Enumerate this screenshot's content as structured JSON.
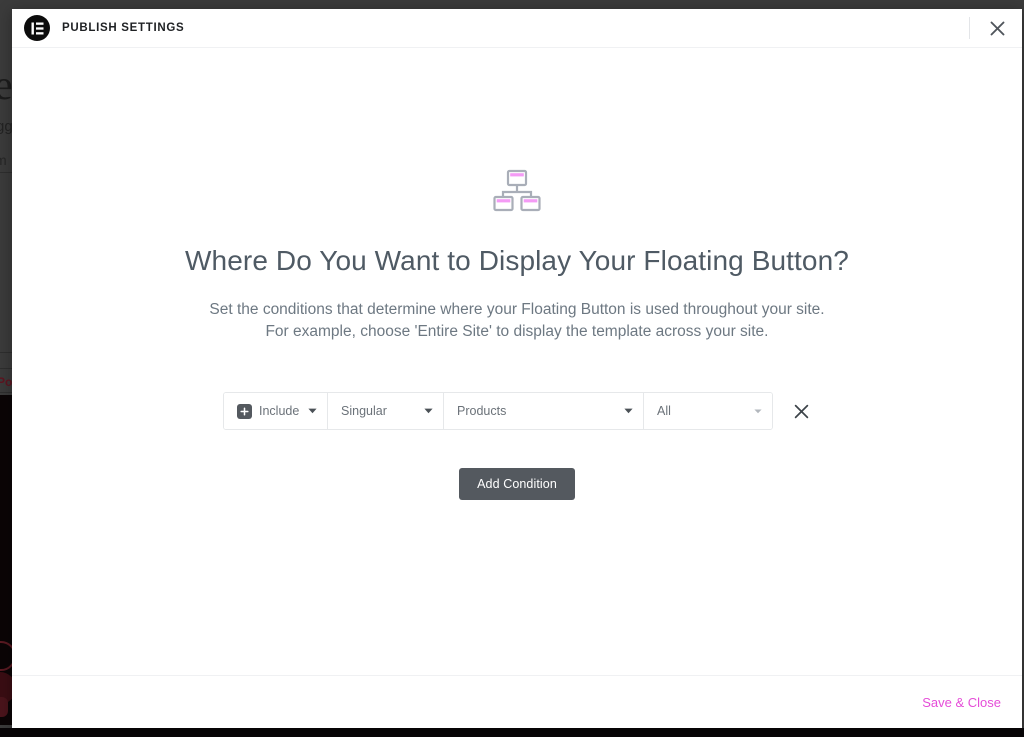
{
  "window": {
    "background_color": "#3b3b3b"
  },
  "background_page": {
    "fragment_e": "e",
    "fragment_gg": "gg",
    "fragment_m": "m",
    "fragment_po": "Po"
  },
  "header": {
    "logo_icon": "elementor-logo-icon",
    "title": "PUBLISH SETTINGS",
    "close_icon": "close-icon"
  },
  "main": {
    "illustration_icon": "sitemap-hierarchy-icon",
    "headline": "Where Do You Want to Display Your Floating Button?",
    "description_line1": "Set the conditions that determine where your Floating Button is used throughout your site.",
    "description_line2": "For example, choose 'Entire Site' to display the template across your site.",
    "conditions": [
      {
        "type_icon": "plus-icon",
        "type": "Include",
        "scope": "Singular",
        "object": "Products",
        "value": "All",
        "remove_icon": "close-icon"
      }
    ],
    "add_condition_label": "Add Condition"
  },
  "footer": {
    "save_close_label": "Save & Close"
  },
  "colors": {
    "accent_pink": "#e54dd8",
    "button_gray": "#54595f",
    "heading_gray": "#4f5a64",
    "body_gray": "#6d7882",
    "border_gray": "#e6e8ea"
  }
}
